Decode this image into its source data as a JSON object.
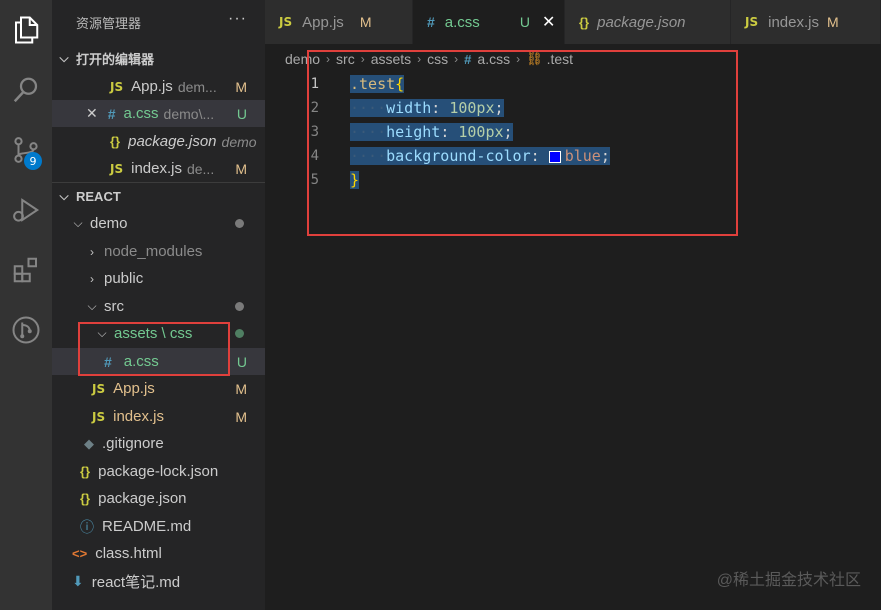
{
  "activity": {
    "badge": "9"
  },
  "sidebar": {
    "title": "资源管理器",
    "more": "···",
    "open_editors": {
      "header": "打开的编辑器",
      "items": [
        {
          "icon": "JS",
          "name": "App.js",
          "path": "dem...",
          "status": "M"
        },
        {
          "icon": "#",
          "name": "a.css",
          "path": "demo\\...",
          "status": "U",
          "close": "✕"
        },
        {
          "icon": "{}",
          "name": "package.json",
          "path": "demo",
          "status": ""
        },
        {
          "icon": "JS",
          "name": "index.js",
          "path": "de...",
          "status": "M"
        }
      ]
    },
    "project": {
      "header": "REACT",
      "tree": [
        {
          "name": "demo",
          "status": ""
        },
        {
          "name": "node_modules",
          "status": ""
        },
        {
          "name": "public",
          "status": ""
        },
        {
          "name": "src",
          "status": ""
        },
        {
          "name": "assets \\ css",
          "status": ""
        },
        {
          "name": "a.css",
          "status": "U"
        },
        {
          "name": "App.js",
          "status": "M"
        },
        {
          "name": "index.js",
          "status": "M"
        },
        {
          "name": ".gitignore",
          "status": ""
        },
        {
          "name": "package-lock.json",
          "status": ""
        },
        {
          "name": "package.json",
          "status": ""
        },
        {
          "name": "README.md",
          "status": ""
        },
        {
          "name": "class.html",
          "status": ""
        },
        {
          "name": "react笔记.md",
          "status": ""
        }
      ]
    }
  },
  "tabs": [
    {
      "icon": "JS",
      "label": "App.js",
      "status": "M"
    },
    {
      "icon": "#",
      "label": "a.css",
      "status": "U",
      "close": "✕"
    },
    {
      "icon": "{}",
      "label": "package.json",
      "status": ""
    },
    {
      "icon": "JS",
      "label": "index.js",
      "status": "M"
    }
  ],
  "breadcrumb": [
    "demo",
    "src",
    "assets",
    "css",
    "a.css",
    ".test"
  ],
  "editor": {
    "line_numbers": [
      "1",
      "2",
      "3",
      "4",
      "5"
    ],
    "code": {
      "selector": ".test",
      "open_brace": "{",
      "close_brace": "}",
      "width_prop": "width",
      "width_val": "100px",
      "height_prop": "height",
      "height_val": "100px",
      "bg_prop": "background-color",
      "bg_val": "blue",
      "colon": ":",
      "semi": ";",
      "indent": "····"
    },
    "swatch_color": "#0000ff"
  },
  "watermark": "@稀土掘金技术社区"
}
